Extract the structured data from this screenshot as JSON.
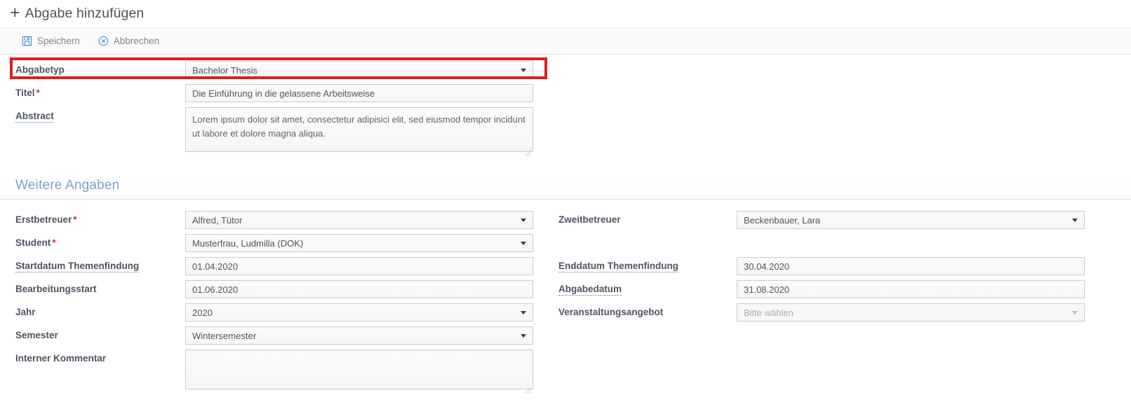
{
  "header": {
    "title": "Abgabe hinzufügen",
    "plus_icon": "plus-icon"
  },
  "toolbar": {
    "save_label": "Speichern",
    "save_icon": "floppy-disk-icon",
    "cancel_label": "Abbrechen",
    "cancel_icon": "circle-x-icon"
  },
  "highlight": {
    "color": "#e51b1b",
    "target": "abgabetyp-select"
  },
  "top_fields": {
    "abgabetyp": {
      "label": "Abgabetyp",
      "value": "Bachelor Thesis",
      "type": "select",
      "required": false
    },
    "titel": {
      "label": "Titel",
      "value": "Die Einführung in die gelassene Arbeitsweise",
      "type": "text",
      "required": true,
      "required_marker": "*"
    },
    "abstract": {
      "label": "Abstract",
      "value": "Lorem ipsum dolor sit amet, consectetur adipisici elit, sed eiusmod tempor incidunt ut labore et dolore magna aliqua.",
      "type": "textarea",
      "required": false,
      "has_tooltip": true
    }
  },
  "section": {
    "title": "Weitere Angaben",
    "color": "#7fa1cb"
  },
  "left_column": [
    {
      "name": "erstbetreuer",
      "label": "Erstbetreuer",
      "value": "Alfred, Tütor",
      "type": "select",
      "required": true,
      "required_marker": "*",
      "has_tooltip": false
    },
    {
      "name": "student",
      "label": "Student",
      "value": "Musterfrau, Ludmilla (DOK)",
      "type": "select",
      "required": true,
      "required_marker": "*",
      "has_tooltip": false
    },
    {
      "name": "startdatum-themenfindung",
      "label": "Startdatum Themenfindung",
      "value": "01.04.2020",
      "type": "text",
      "required": false,
      "has_tooltip": true
    },
    {
      "name": "bearbeitungsstart",
      "label": "Bearbeitungsstart",
      "value": "01.06.2020",
      "type": "text",
      "required": false,
      "has_tooltip": false
    },
    {
      "name": "jahr",
      "label": "Jahr",
      "value": "2020",
      "type": "select",
      "required": false,
      "has_tooltip": false
    },
    {
      "name": "semester",
      "label": "Semester",
      "value": "Wintersemester",
      "type": "select",
      "required": false,
      "has_tooltip": false
    },
    {
      "name": "interner-kommentar",
      "label": "Interner Kommentar",
      "value": "",
      "type": "textarea",
      "required": false,
      "has_tooltip": false
    }
  ],
  "right_column": [
    {
      "name": "zweitbetreuer",
      "label": "Zweitbetreuer",
      "value": "Beckenbauer, Lara",
      "type": "select",
      "required": false,
      "has_tooltip": false
    },
    {
      "name": "enddatum-themenfindung",
      "label": "Enddatum Themenfindung",
      "value": "30.04.2020",
      "type": "text",
      "required": false,
      "has_tooltip": true
    },
    {
      "name": "abgabedatum",
      "label": "Abgabedatum",
      "value": "31.08.2020",
      "type": "text",
      "required": false,
      "has_tooltip": true
    },
    {
      "name": "veranstaltungsangebot",
      "label": "Veranstaltungsangebot",
      "value": "",
      "placeholder": "Bitte wählen",
      "type": "select",
      "required": false,
      "disabled": true,
      "has_tooltip": false
    }
  ]
}
